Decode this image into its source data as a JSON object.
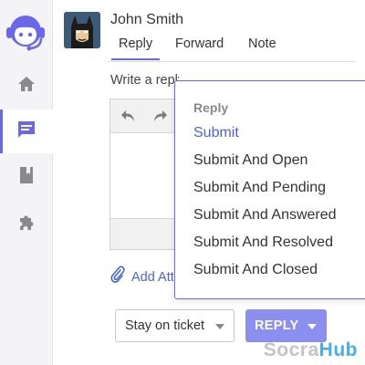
{
  "sidebar": {
    "logo_icon": "headset-agent-logo-icon",
    "items": [
      {
        "icon": "home-icon"
      },
      {
        "icon": "tickets-chat-icon",
        "active": true
      },
      {
        "icon": "knowledgebase-book-icon"
      },
      {
        "icon": "apps-puzzle-icon"
      }
    ]
  },
  "ticket": {
    "customer_name": "John Smith",
    "tabs": [
      {
        "label": "Reply",
        "active": true
      },
      {
        "label": "Forward"
      },
      {
        "label": "Note"
      }
    ],
    "reply_placeholder": "Write a reply",
    "attach_label": "Add Attachment"
  },
  "actions": {
    "status_value": "Stay on ticket",
    "reply_button_label": "REPLY"
  },
  "dropdown": {
    "header": "Reply",
    "items": [
      {
        "label": "Submit",
        "active": true
      },
      {
        "label": "Submit And Open"
      },
      {
        "label": "Submit And Pending"
      },
      {
        "label": "Submit And Answered"
      },
      {
        "label": "Submit And Resolved"
      },
      {
        "label": "Submit And Closed"
      }
    ]
  },
  "watermark": {
    "part1": "Socra",
    "part2": "Hub"
  },
  "colors": {
    "accent": "#6a68e8",
    "link": "#4a63d8",
    "reply_button": "#8b8ff0",
    "sidebar_bg": "#f4f4f6"
  }
}
